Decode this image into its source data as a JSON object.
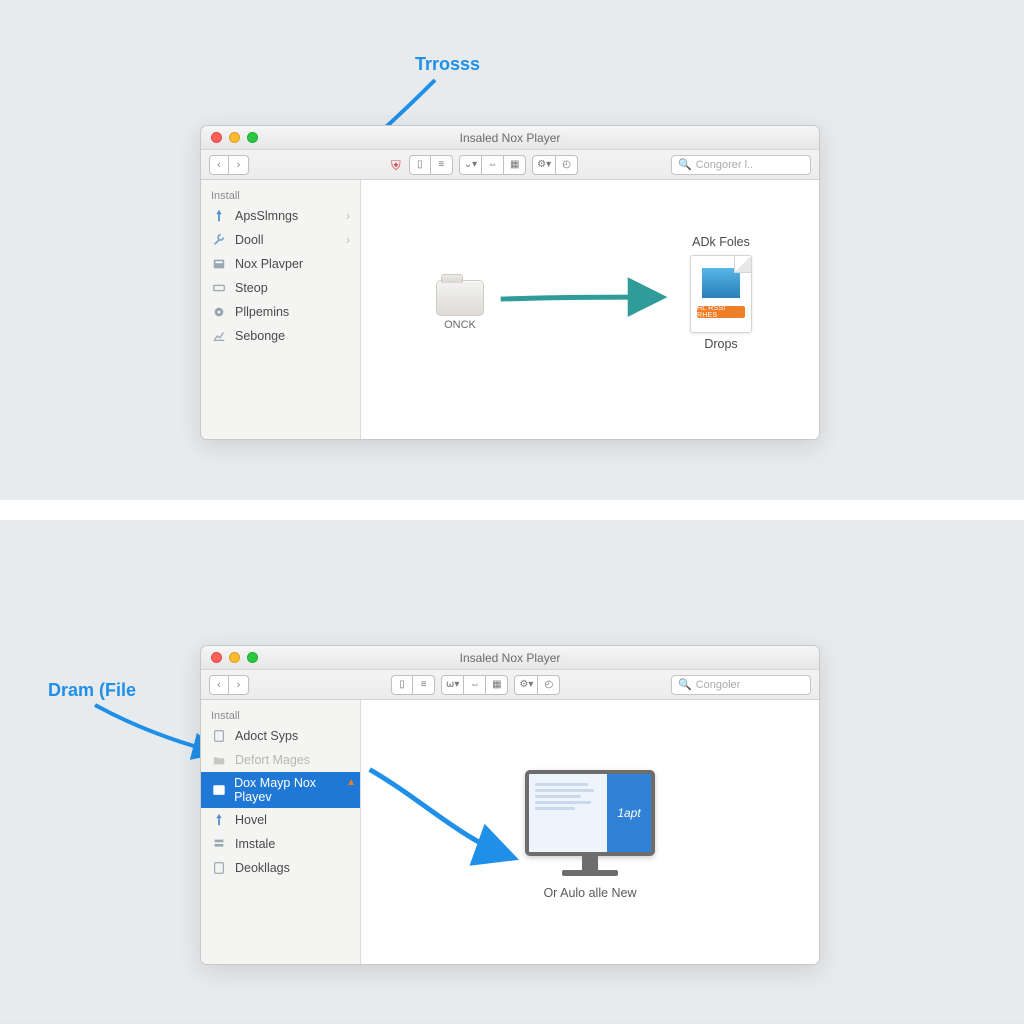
{
  "panel1": {
    "callout": "Trrosss",
    "window": {
      "title": "Insaled Nox Player",
      "search_placeholder": "Congorer l..",
      "sidebar_header": "Install",
      "sidebar": [
        {
          "label": "ApsSlmngs",
          "chev": true
        },
        {
          "label": "Dooll",
          "chev": true
        },
        {
          "label": "Nox Plavper",
          "chev": false
        },
        {
          "label": "Steop",
          "chev": false
        },
        {
          "label": "Pllpemins",
          "chev": false
        },
        {
          "label": "Sebonge",
          "chev": false
        }
      ],
      "folder_label": "ONCK",
      "file_top_caption": "ADk Foles",
      "file_badge": "HL RSSI RHES",
      "file_bottom_caption": "Drops"
    }
  },
  "panel2": {
    "callout": "Dram (File",
    "window": {
      "title": "Insaled Nox Player",
      "search_placeholder": "Congoler",
      "sidebar_header": "Install",
      "sidebar": [
        {
          "label": "Adoct Syps"
        },
        {
          "label": "Defort Mages",
          "muted": true
        },
        {
          "label": "Dox Mayp Nox Playev",
          "selected": true,
          "flame": true
        },
        {
          "label": "Hovel"
        },
        {
          "label": "Imstale"
        },
        {
          "label": "Deokllags"
        }
      ],
      "screen_script": "1apt",
      "monitor_caption": "Or Aulo alle New"
    }
  }
}
